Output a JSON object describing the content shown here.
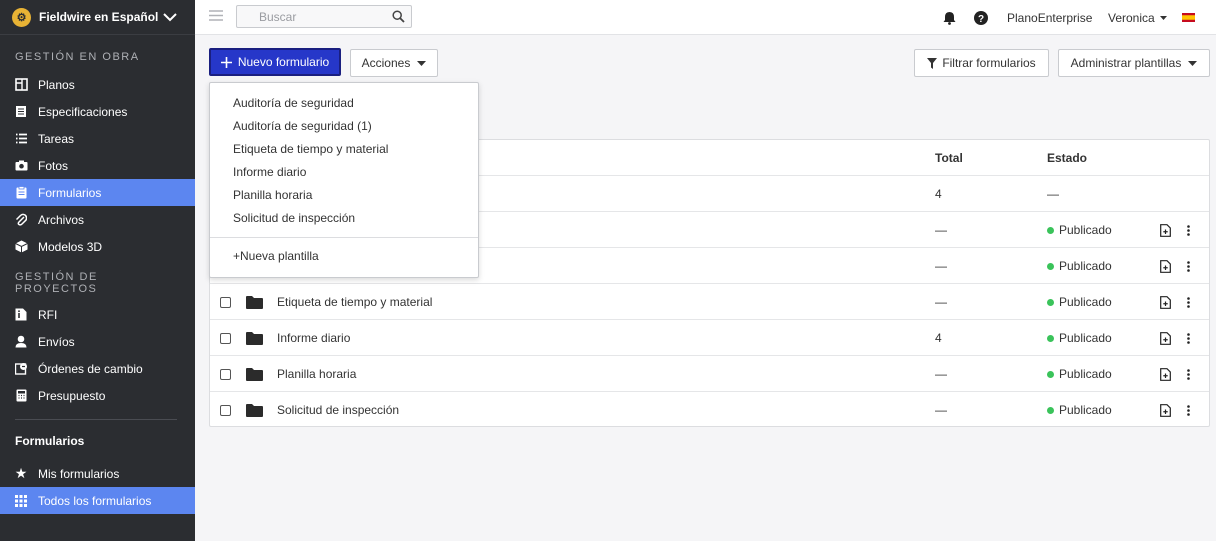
{
  "sidebar": {
    "brand": "Fieldwire en Español",
    "sections": [
      {
        "title": "GESTIÓN EN OBRA"
      },
      {
        "title": "GESTIÓN DE PROYECTOS"
      }
    ],
    "obra_items": [
      {
        "label": "Planos",
        "icon": "plans-icon"
      },
      {
        "label": "Especificaciones",
        "icon": "specs-icon"
      },
      {
        "label": "Tareas",
        "icon": "list-icon"
      },
      {
        "label": "Fotos",
        "icon": "camera-icon"
      },
      {
        "label": "Formularios",
        "icon": "clipboard-icon"
      },
      {
        "label": "Archivos",
        "icon": "paperclip-icon"
      },
      {
        "label": "Modelos 3D",
        "icon": "cube-icon"
      }
    ],
    "proyectos_items": [
      {
        "label": "RFI",
        "icon": "rfi-icon"
      },
      {
        "label": "Envíos",
        "icon": "person-icon"
      },
      {
        "label": "Órdenes de cambio",
        "icon": "change-order-icon"
      },
      {
        "label": "Presupuesto",
        "icon": "calculator-icon"
      }
    ],
    "forms_title": "Formularios",
    "forms_items": [
      {
        "label": "Mis formularios",
        "icon": "star-icon"
      },
      {
        "label": "Todos los formularios",
        "icon": "grid-icon"
      }
    ]
  },
  "topbar": {
    "search_placeholder": "Buscar",
    "plan": "PlanoEnterprise",
    "user": "Veronica"
  },
  "toolbar": {
    "new_form": "Nuevo formulario",
    "actions": "Acciones",
    "filter": "Filtrar formularios",
    "admin": "Administrar plantillas"
  },
  "dropdown": {
    "items": [
      "Auditoría de seguridad",
      "Auditoría de seguridad (1)",
      "Etiqueta de tiempo y material",
      "Informe diario",
      "Planilla horaria",
      "Solicitud de inspección"
    ],
    "new_template": "+Nueva plantilla"
  },
  "table": {
    "headers": {
      "total": "Total",
      "estado": "Estado"
    },
    "rows": [
      {
        "name": "",
        "total": "4",
        "estado": "—",
        "published": false
      },
      {
        "name": "",
        "total": "—",
        "estado": "Publicado",
        "published": true
      },
      {
        "name": "",
        "total": "—",
        "estado": "Publicado",
        "published": true
      },
      {
        "name": "Etiqueta de tiempo y material",
        "total": "—",
        "estado": "Publicado",
        "published": true
      },
      {
        "name": "Informe diario",
        "total": "4",
        "estado": "Publicado",
        "published": true
      },
      {
        "name": "Planilla horaria",
        "total": "—",
        "estado": "Publicado",
        "published": true
      },
      {
        "name": "Solicitud de inspección",
        "total": "—",
        "estado": "Publicado",
        "published": true
      }
    ]
  },
  "colors": {
    "accent": "#5c86f0",
    "primary_button": "#2637c9",
    "sidebar": "#2b2d31",
    "published_dot": "#3ac35a"
  }
}
